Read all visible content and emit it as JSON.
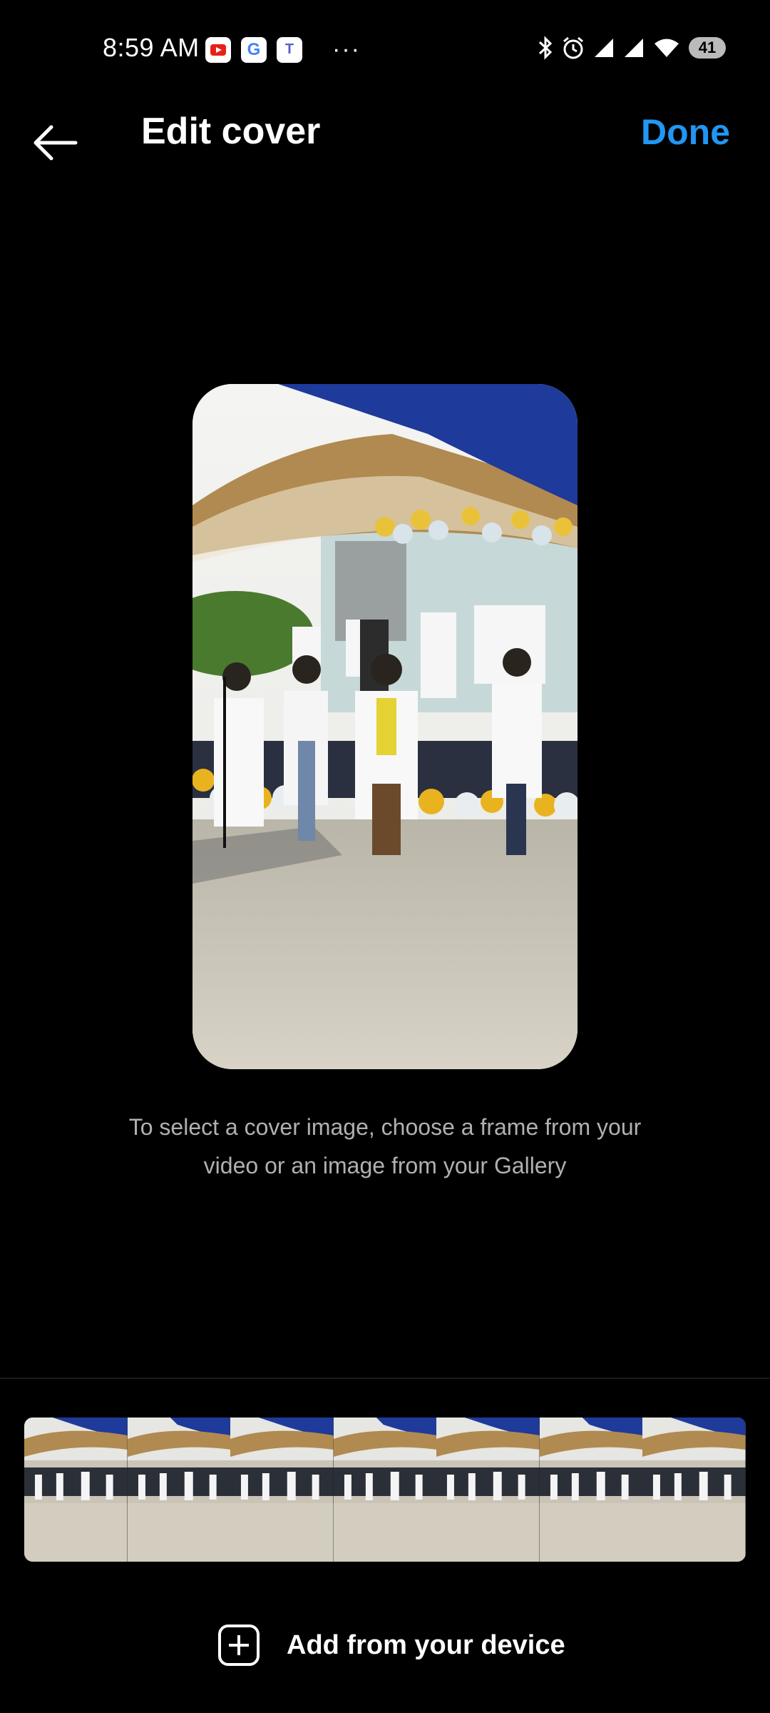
{
  "status_bar": {
    "time": "8:59 AM",
    "app_icons": [
      "youtube-icon",
      "google-icon",
      "teams-icon"
    ],
    "overflow": "···",
    "system_icons": [
      "bluetooth-icon",
      "alarm-icon",
      "signal-icon",
      "signal-icon",
      "wifi-icon"
    ],
    "battery": "41"
  },
  "header": {
    "title": "Edit cover",
    "done_label": "Done"
  },
  "hint": {
    "line1": "To select a cover image, choose a frame from your",
    "line2": "video or an image from your Gallery"
  },
  "filmstrip": {
    "frame_count": 7
  },
  "add_button": {
    "label": "Add from your device"
  },
  "colors": {
    "accent": "#2196f3",
    "background": "#000000",
    "hint_text": "#b0b0b0"
  }
}
